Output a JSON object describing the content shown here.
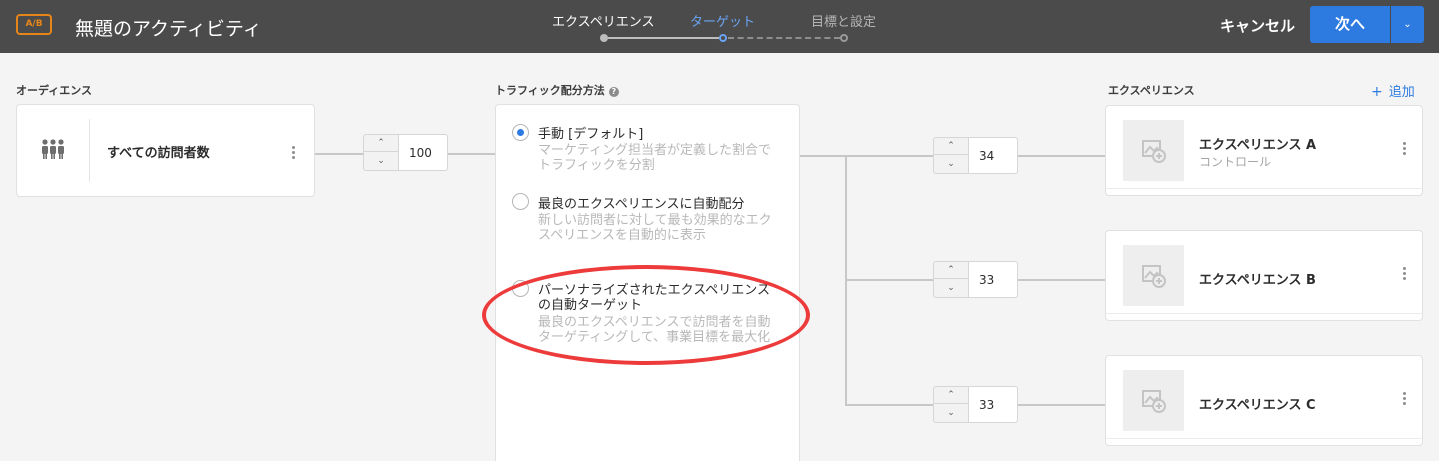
{
  "header": {
    "badge": "A/B",
    "title": "無題のアクティビティ",
    "steps": [
      {
        "label": "エクスペリエンス",
        "state": "complete"
      },
      {
        "label": "ターゲット",
        "state": "current"
      },
      {
        "label": "目標と設定",
        "state": "upcoming"
      }
    ],
    "cancel_label": "キャンセル",
    "next_label": "次へ",
    "next_dropdown_icon": "chevron-down-icon"
  },
  "audience": {
    "section_label": "オーディエンス",
    "card": {
      "icon": "people-group-icon",
      "name": "すべての訪問者数"
    },
    "allocation": "100"
  },
  "traffic": {
    "section_label": "トラフィック配分方法",
    "help_icon": "?",
    "options": [
      {
        "label": "手動 [デフォルト]",
        "description": "マーケティング担当者が定義した割合でトラフィックを分割",
        "selected": true
      },
      {
        "label": "最良のエクスペリエンスに自動配分",
        "description": "新しい訪問者に対して最も効果的なエクスペリエンスを自動的に表示",
        "selected": false
      },
      {
        "label": "パーソナライズされたエクスペリエンスの自動ターゲット",
        "description": "最良のエクスペリエンスで訪問者を自動ターゲティングして、事業目標を最大化",
        "selected": false
      }
    ],
    "highlight_color": "#ed3a3a"
  },
  "experiences": {
    "section_label": "エクスペリエンス",
    "add_icon": "+",
    "add_label": "追加",
    "items": [
      {
        "name": "エクスペリエンス A",
        "subtitle": "コントロール",
        "allocation": "34"
      },
      {
        "name": "エクスペリエンス B",
        "subtitle": "",
        "allocation": "33"
      },
      {
        "name": "エクスペリエンス C",
        "subtitle": "",
        "allocation": "33"
      }
    ]
  },
  "colors": {
    "accent": "#2d7be0",
    "header_bg": "#4b4b4b",
    "badge": "#e68619"
  }
}
